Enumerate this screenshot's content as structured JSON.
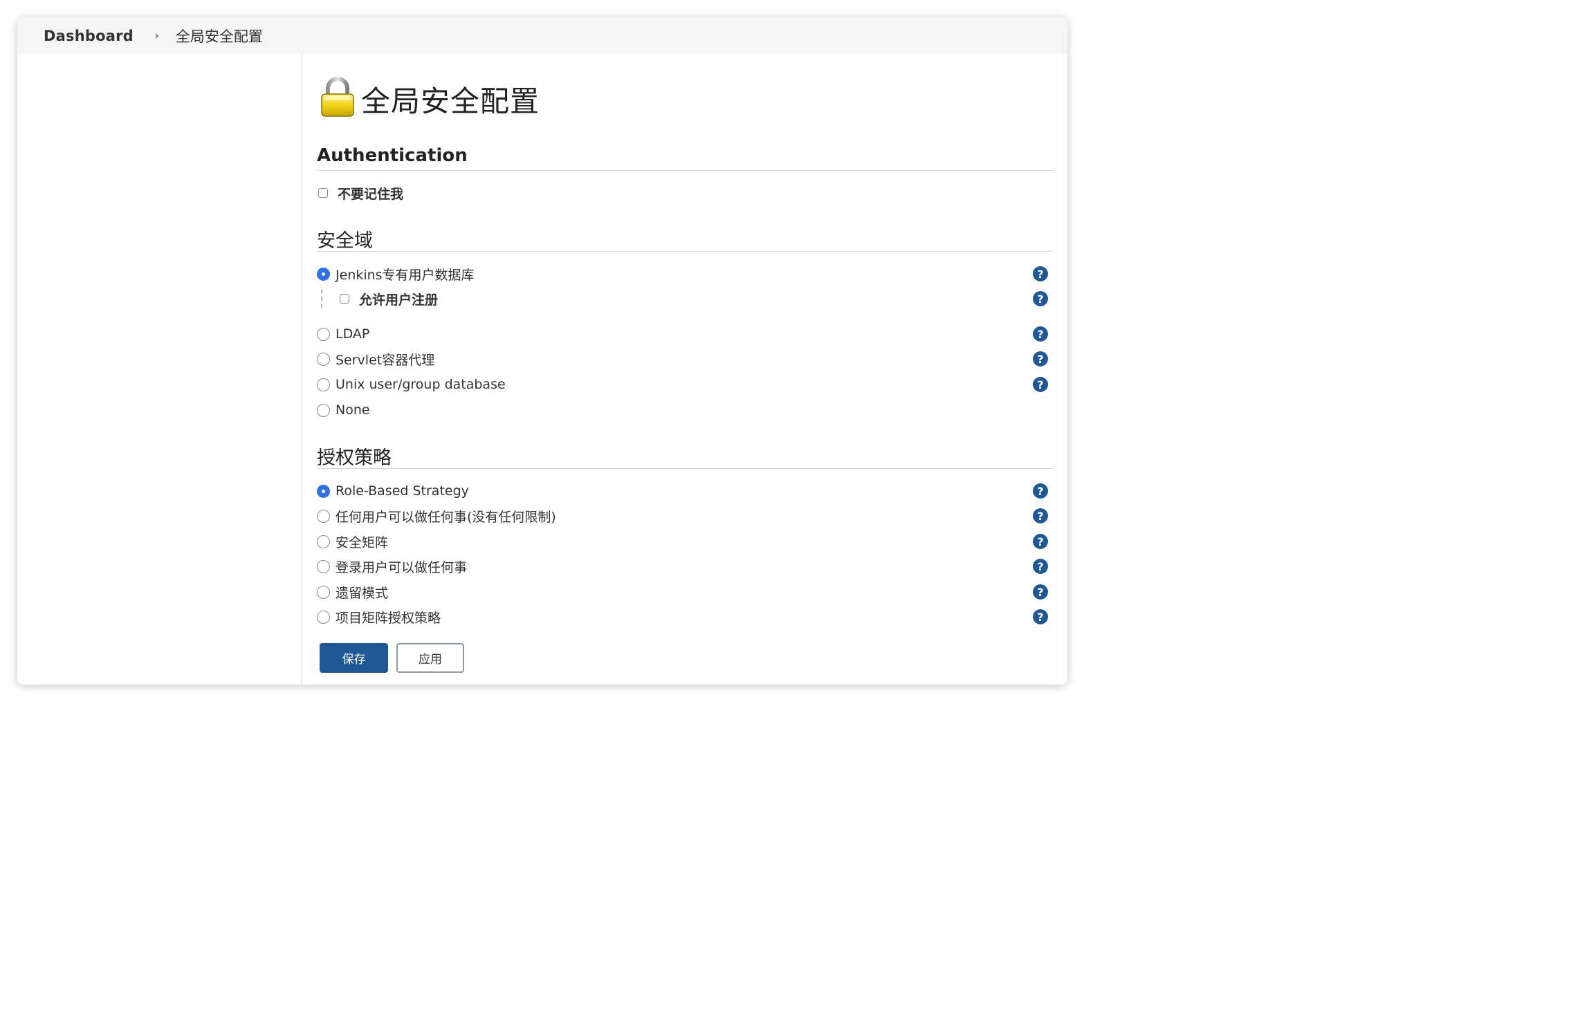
{
  "breadcrumb": {
    "home": "Dashboard",
    "current": "全局安全配置"
  },
  "page": {
    "title": "全局安全配置",
    "title_icon": "padlock-icon"
  },
  "authentication": {
    "title": "Authentication",
    "options": [
      {
        "label": "不要记住我",
        "checked": false
      }
    ]
  },
  "security_realm": {
    "title": "安全域",
    "options": [
      {
        "label": "Jenkins专有用户数据库",
        "selected": true,
        "help": "?"
      },
      {
        "label": "LDAP",
        "selected": false,
        "help": "?"
      },
      {
        "label": "Servlet容器代理",
        "selected": false,
        "help": "?"
      },
      {
        "label": "Unix user/group database",
        "selected": false,
        "help": "?"
      },
      {
        "label": "None",
        "selected": false
      }
    ],
    "sub_options": [
      {
        "label": "允许用户注册",
        "checked": false,
        "help": "?"
      }
    ]
  },
  "authorization": {
    "title": "授权策略",
    "options": [
      {
        "label": "Role-Based Strategy",
        "selected": true,
        "help": "?"
      },
      {
        "label": "任何用户可以做任何事(没有任何限制)",
        "selected": false,
        "help": "?"
      },
      {
        "label": "安全矩阵",
        "selected": false,
        "help": "?"
      },
      {
        "label": "登录用户可以做任何事",
        "selected": false,
        "help": "?"
      },
      {
        "label": "遗留模式",
        "selected": false,
        "help": "?"
      },
      {
        "label": "项目矩阵授权策略",
        "selected": false,
        "help": "?"
      }
    ]
  },
  "buttons": {
    "save": "保存",
    "apply": "应用"
  },
  "colors": {
    "primary": "#1f5896",
    "radio_selected": "#2f6fe8",
    "breadcrumb_bg": "#f5f5f5",
    "padlock": "#f2d21b"
  }
}
